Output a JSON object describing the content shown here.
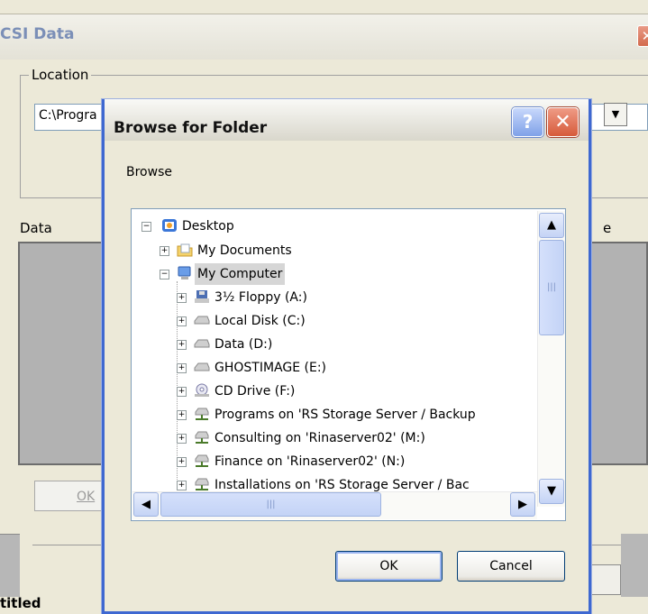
{
  "background_window": {
    "title": "CSI Data",
    "close_glyph": "✕",
    "location_label": "Location",
    "location_value": "C:\\Progra",
    "combo_arrow_glyph": "▼",
    "data_label": "Data",
    "partial_right_label": "e",
    "ok_button": "OK",
    "partial_bottom_text": "titled"
  },
  "dialog": {
    "title": "Browse for Folder",
    "help_glyph": "?",
    "close_glyph": "✕",
    "instruction": "Browse",
    "tree": [
      {
        "label": "Desktop",
        "icon": "desktop-icon",
        "expander": "−",
        "level": 0
      },
      {
        "label": "My Documents",
        "icon": "folder-icon",
        "expander": "+",
        "level": 1
      },
      {
        "label": "My Computer",
        "icon": "computer-icon",
        "expander": "−",
        "level": 1,
        "selected": true
      },
      {
        "label": "3½ Floppy (A:)",
        "icon": "floppy-icon",
        "expander": "+",
        "level": 2
      },
      {
        "label": "Local Disk (C:)",
        "icon": "drive-icon",
        "expander": "+",
        "level": 2
      },
      {
        "label": "Data (D:)",
        "icon": "drive-icon",
        "expander": "+",
        "level": 2
      },
      {
        "label": "GHOSTIMAGE (E:)",
        "icon": "drive-icon",
        "expander": "+",
        "level": 2
      },
      {
        "label": "CD Drive (F:)",
        "icon": "cd-drive-icon",
        "expander": "+",
        "level": 2
      },
      {
        "label": "Programs on 'RS Storage Server / Backup",
        "icon": "network-drive-icon",
        "expander": "+",
        "level": 2
      },
      {
        "label": "Consulting on 'Rinaserver02' (M:)",
        "icon": "network-drive-icon",
        "expander": "+",
        "level": 2
      },
      {
        "label": "Finance on 'Rinaserver02' (N:)",
        "icon": "network-drive-icon",
        "expander": "+",
        "level": 2
      },
      {
        "label": "Installations on 'RS Storage Server / Bac",
        "icon": "network-drive-icon",
        "expander": "+",
        "level": 2
      }
    ],
    "scroll": {
      "up": "▲",
      "down": "▼",
      "left": "◀",
      "right": "▶",
      "grip": "|||"
    },
    "ok_button": "OK",
    "cancel_button": "Cancel"
  }
}
